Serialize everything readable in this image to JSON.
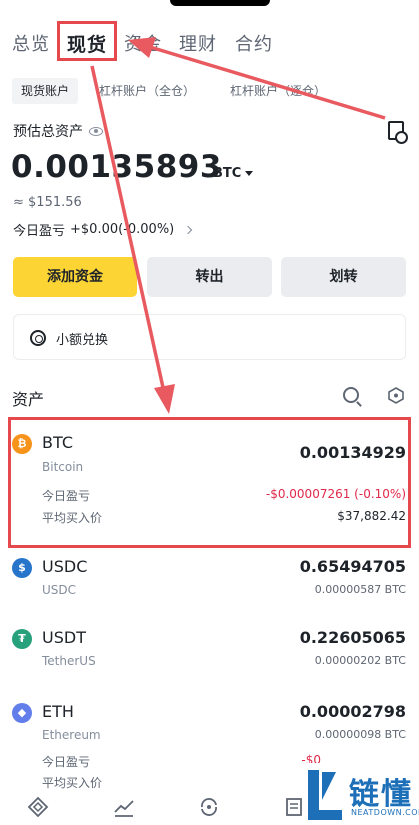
{
  "top_tabs": [
    "总览",
    "现货",
    "资金",
    "理财",
    "合约"
  ],
  "active_top_tab": "现货",
  "sub_tabs": [
    "现货账户",
    "杠杆账户（全仓）",
    "杠杆账户（逐仓）"
  ],
  "summary": {
    "label": "预估总资产",
    "value": "0.00135893",
    "unit": "BTC",
    "usd": "≈ $151.56",
    "pnl_label": "今日盈亏",
    "pnl_value": "+$0.00(-0.00%)"
  },
  "actions": {
    "add_funds": "添加资金",
    "withdraw": "转出",
    "transfer": "划转"
  },
  "small_swap": "小额兑换",
  "assets_title": "资产",
  "assets": [
    {
      "symbol": "BTC",
      "name": "Bitcoin",
      "amount": "0.00134929",
      "pnl_label": "今日盈亏",
      "pnl": "-$0.00007261 (-0.10%)",
      "avg_label": "平均买入价",
      "avg_price": "$37,882.42",
      "color": "#f7931a",
      "icon": "bitcoin-icon"
    },
    {
      "symbol": "USDC",
      "name": "USDC",
      "amount": "0.65494705",
      "value": "0.00000587 BTC",
      "color": "#2775ca",
      "icon": "usdc-icon"
    },
    {
      "symbol": "USDT",
      "name": "TetherUS",
      "amount": "0.22605065",
      "value": "0.00000202 BTC",
      "color": "#26a17b",
      "icon": "tether-icon"
    },
    {
      "symbol": "ETH",
      "name": "Ethereum",
      "amount": "0.00002798",
      "value": "0.00000098 BTC",
      "pnl_label": "今日盈亏",
      "pnl_partial": "-$0",
      "avg_label": "平均买入价",
      "color": "#627eea",
      "icon": "ethereum-icon"
    }
  ],
  "watermark": {
    "text": "链懂",
    "sub": "NEATDOWN.COM"
  }
}
